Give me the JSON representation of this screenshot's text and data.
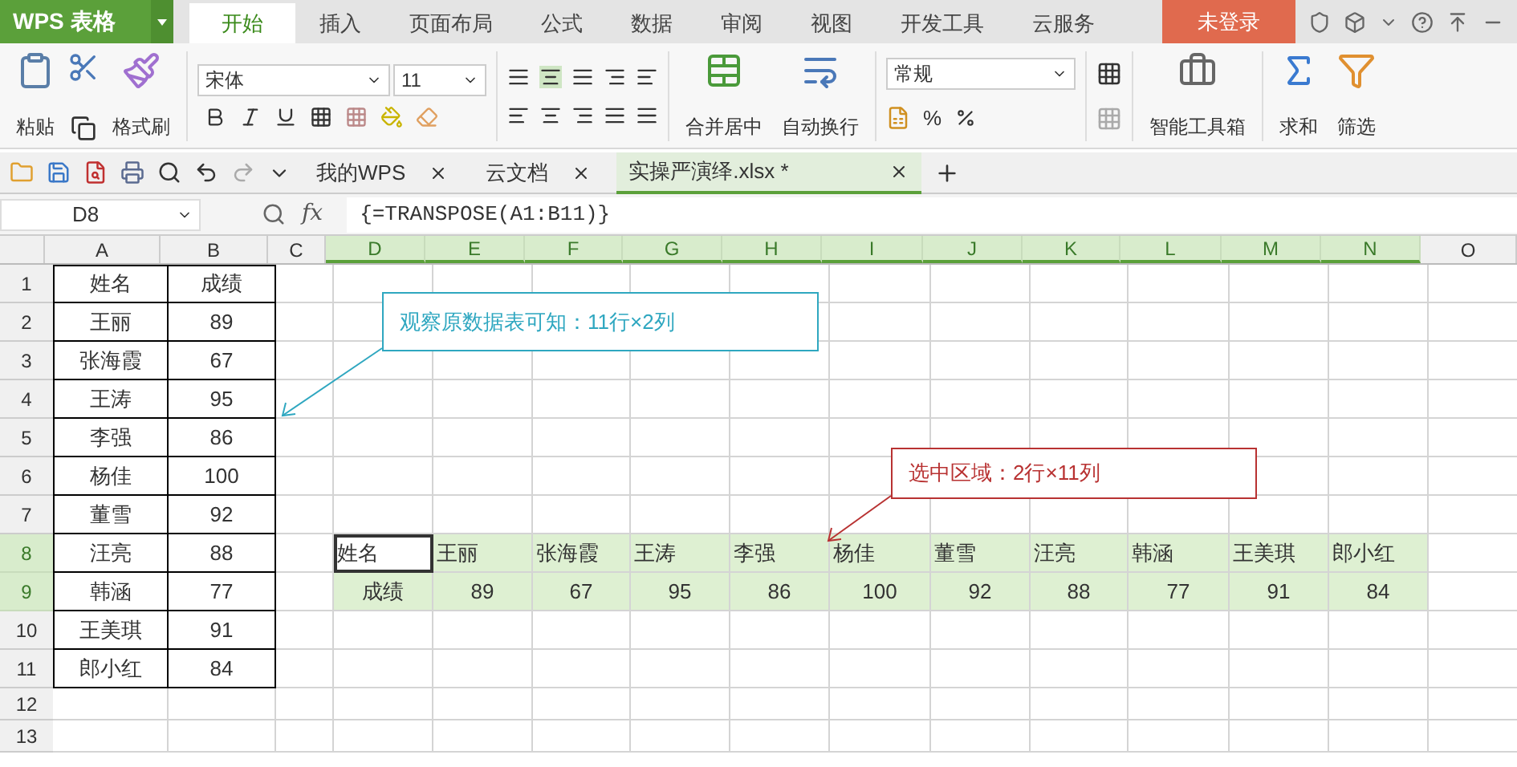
{
  "app_button": {
    "label": "WPS 表格"
  },
  "menu_tabs": [
    {
      "label": "开始",
      "selected": true
    },
    {
      "label": "插入",
      "selected": false
    },
    {
      "label": "页面布局",
      "selected": false
    },
    {
      "label": "公式",
      "selected": false
    },
    {
      "label": "数据",
      "selected": false
    },
    {
      "label": "审阅",
      "selected": false
    },
    {
      "label": "视图",
      "selected": false
    },
    {
      "label": "开发工具",
      "selected": false
    },
    {
      "label": "云服务",
      "selected": false
    }
  ],
  "login_button": "未登录",
  "ribbon": {
    "paste": "粘贴",
    "format_painter": "格式刷",
    "font": "宋体",
    "font_size": "11",
    "merge": "合并居中",
    "wrap": "自动换行",
    "number_format": "常规",
    "percent": "%",
    "toolbox": "智能工具箱",
    "sum": "求和",
    "filter": "筛选"
  },
  "doc_tabs": [
    {
      "label": "我的WPS",
      "selected": false
    },
    {
      "label": "云文档",
      "selected": false
    },
    {
      "label": "实操严演绎.xlsx *",
      "selected": true
    }
  ],
  "name_box": "D8",
  "function_label": "fx",
  "formula": "{=TRANSPOSE(A1:B11)}",
  "columns": [
    {
      "label": "A",
      "selected": false
    },
    {
      "label": "B",
      "selected": false
    },
    {
      "label": "C",
      "selected": false
    },
    {
      "label": "D",
      "selected": true
    },
    {
      "label": "E",
      "selected": true
    },
    {
      "label": "F",
      "selected": true
    },
    {
      "label": "G",
      "selected": true
    },
    {
      "label": "H",
      "selected": true
    },
    {
      "label": "I",
      "selected": true
    },
    {
      "label": "J",
      "selected": true
    },
    {
      "label": "K",
      "selected": true
    },
    {
      "label": "L",
      "selected": true
    },
    {
      "label": "M",
      "selected": true
    },
    {
      "label": "N",
      "selected": true
    },
    {
      "label": "O",
      "selected": false
    }
  ],
  "rows": [
    {
      "label": "1",
      "selected": false
    },
    {
      "label": "2",
      "selected": false
    },
    {
      "label": "3",
      "selected": false
    },
    {
      "label": "4",
      "selected": false
    },
    {
      "label": "5",
      "selected": false
    },
    {
      "label": "6",
      "selected": false
    },
    {
      "label": "7",
      "selected": false
    },
    {
      "label": "8",
      "selected": true
    },
    {
      "label": "9",
      "selected": true
    },
    {
      "label": "10",
      "selected": false
    },
    {
      "label": "11",
      "selected": false
    },
    {
      "label": "12",
      "selected": false
    },
    {
      "label": "13",
      "selected": false
    }
  ],
  "source_table": [
    [
      "姓名",
      "成绩"
    ],
    [
      "王丽",
      "89"
    ],
    [
      "张海霞",
      "67"
    ],
    [
      "王涛",
      "95"
    ],
    [
      "李强",
      "86"
    ],
    [
      "杨佳",
      "100"
    ],
    [
      "董雪",
      "92"
    ],
    [
      "汪亮",
      "88"
    ],
    [
      "韩涵",
      "77"
    ],
    [
      "王美琪",
      "91"
    ],
    [
      "郎小红",
      "84"
    ]
  ],
  "transposed": [
    [
      "姓名",
      "王丽",
      "张海霞",
      "王涛",
      "李强",
      "杨佳",
      "董雪",
      "汪亮",
      "韩涵",
      "王美琪",
      "郎小红"
    ],
    [
      "成绩",
      "89",
      "67",
      "95",
      "86",
      "100",
      "92",
      "88",
      "77",
      "91",
      "84"
    ]
  ],
  "callouts": [
    {
      "text": "观察原数据表可知：11行×2列",
      "color": "#2fa7c0"
    },
    {
      "text": "选中区域：2行×11列",
      "color": "#b83232"
    }
  ]
}
